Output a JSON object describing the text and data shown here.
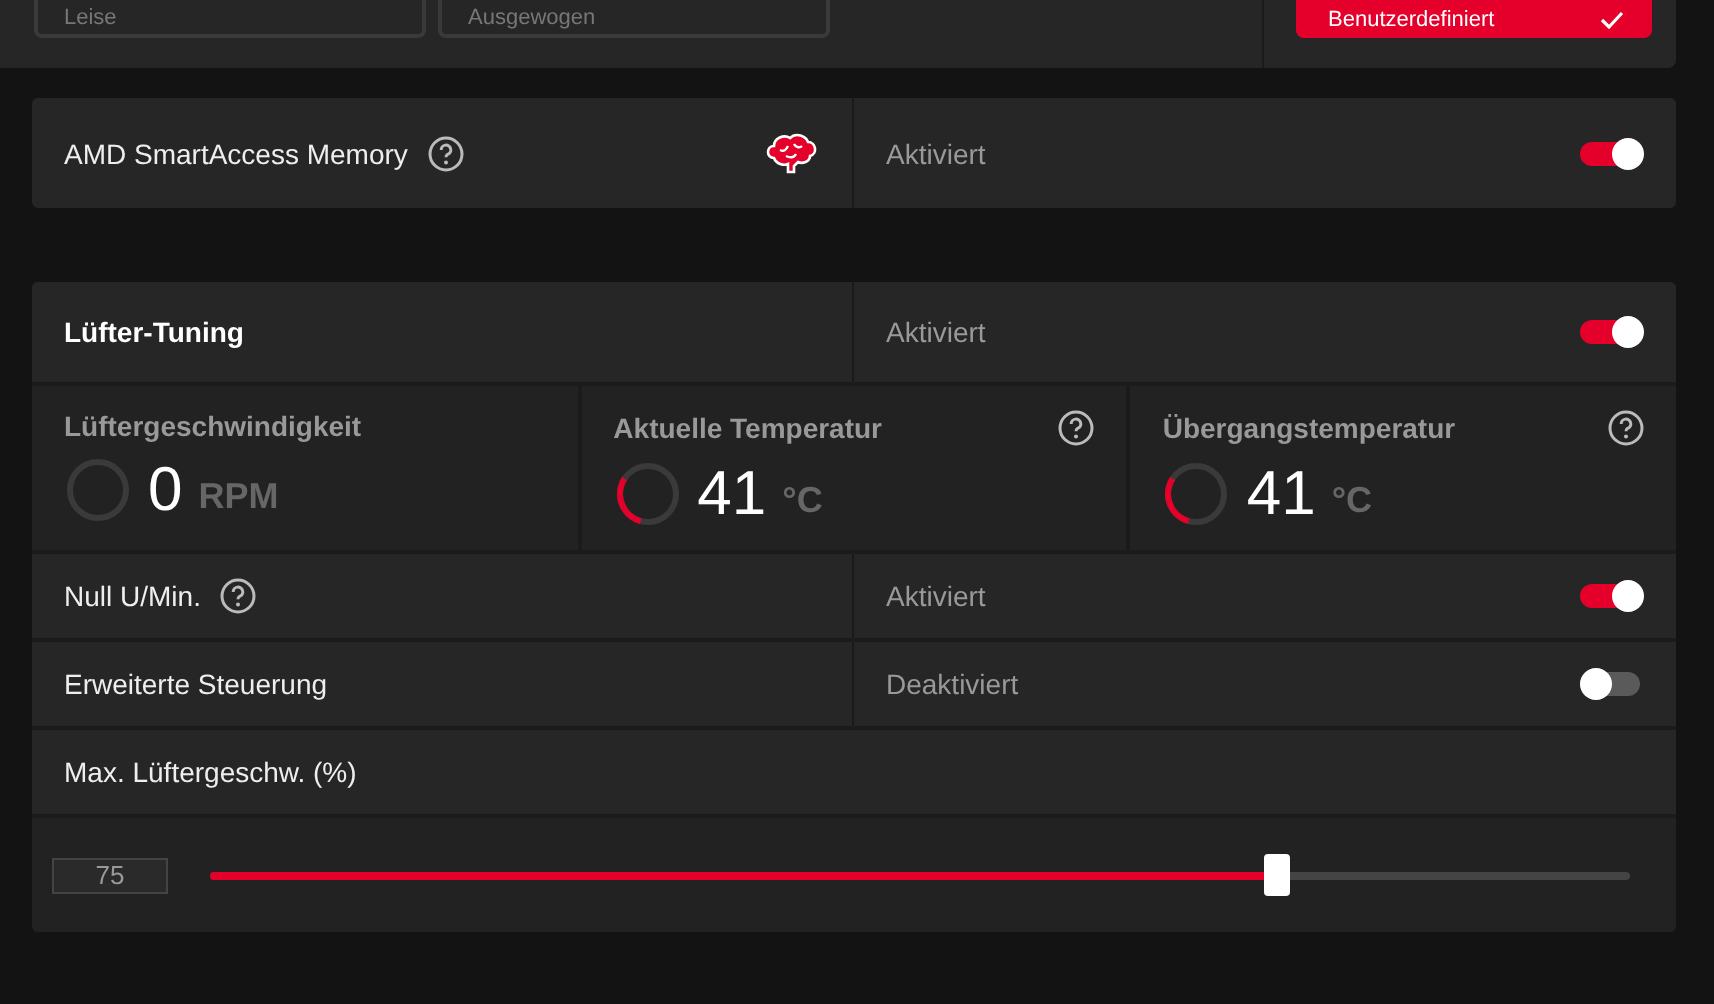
{
  "presets": {
    "options": [
      {
        "label": "Leise",
        "selected": false
      },
      {
        "label": "Ausgewogen",
        "selected": false
      },
      {
        "label": "Benutzerdefiniert",
        "selected": true
      }
    ]
  },
  "smart_access_memory": {
    "label": "AMD SmartAccess Memory",
    "status": "Aktiviert",
    "on": true
  },
  "fan_tuning": {
    "title": "Lüfter-Tuning",
    "status": "Aktiviert",
    "on": true,
    "stats": [
      {
        "label": "Lüftergeschwindigkeit",
        "value": "0",
        "unit": "RPM",
        "level": 0,
        "help": false
      },
      {
        "label": "Aktuelle Temperatur",
        "value": "41",
        "unit": "°C",
        "level": 0.3,
        "help": true
      },
      {
        "label": "Übergangstemperatur",
        "value": "41",
        "unit": "°C",
        "level": 0.3,
        "help": true
      }
    ],
    "settings": [
      {
        "label": "Null U/Min.",
        "help": true,
        "status": "Aktiviert",
        "on": true
      },
      {
        "label": "Erweiterte Steuerung",
        "help": false,
        "status": "Deaktiviert",
        "on": false
      }
    ],
    "max_speed": {
      "label": "Max. Lüftergeschw. (%)",
      "value": "75",
      "level": 0.75
    }
  }
}
